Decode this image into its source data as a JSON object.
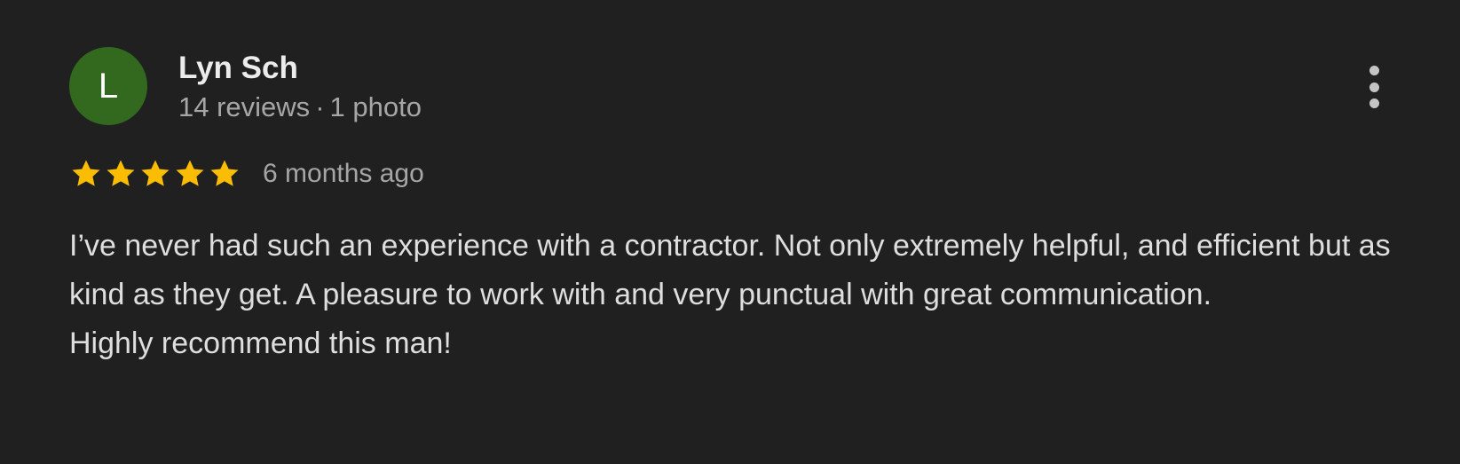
{
  "review": {
    "author": {
      "initial": "L",
      "name": "Lyn Sch",
      "reviews_count": "14 reviews",
      "separator": "·",
      "photos_count": "1 photo"
    },
    "rating": 5,
    "rating_max": 5,
    "date": "6 months ago",
    "text_paragraphs": [
      "I’ve never had such an experience with a contractor. Not only extremely helpful, and efficient but as kind as they get. A pleasure to work with and very punctual with great communication.",
      "Highly recommend this man!"
    ],
    "more_icon": "more-vert-icon",
    "star_icon": "star-icon"
  },
  "colors": {
    "background": "#202020",
    "avatar": "#33691e",
    "star": "#fbbc04",
    "primary_text": "#ececec",
    "secondary_text": "#a6a6a6",
    "body_text": "#dedede"
  }
}
